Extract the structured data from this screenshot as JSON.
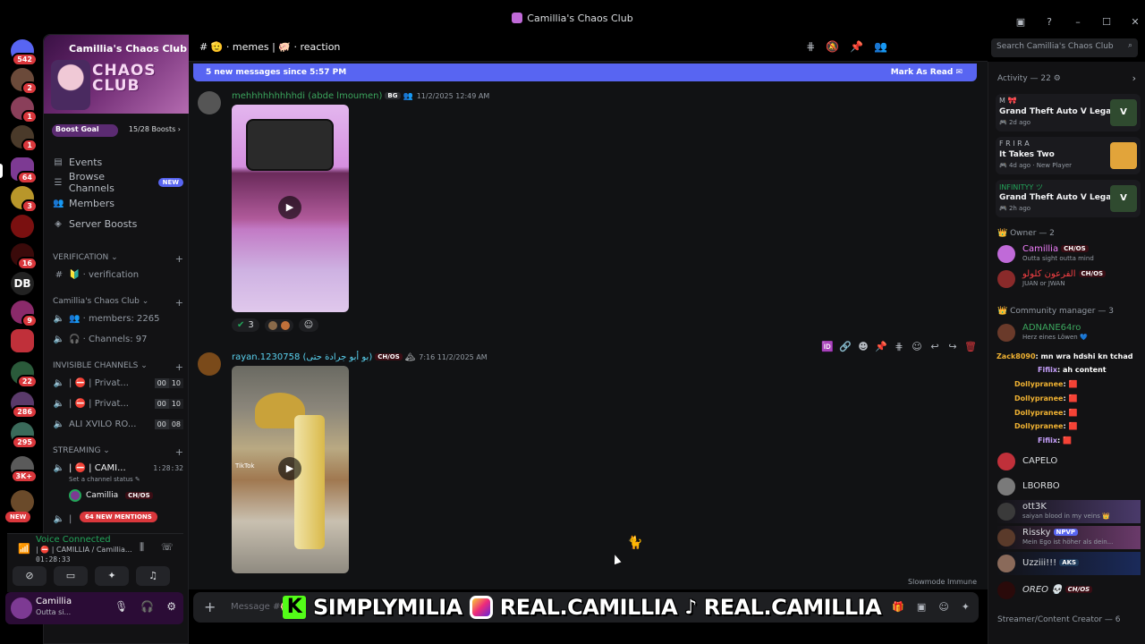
{
  "window": {
    "title": "Camillia's Chaos Club"
  },
  "rail": {
    "badges": [
      "542",
      "2",
      "1",
      "1",
      "64",
      "3",
      "16",
      "9",
      "22",
      "286",
      "295",
      "3K+"
    ],
    "new_label": "NEW"
  },
  "server": {
    "name": "Camillia's Chaos Club",
    "banner_logo_line1": "CHAOS",
    "banner_logo_line2": "CLUB",
    "boost_goal": "Boost Goal",
    "boost_count": "15/28 Boosts ›"
  },
  "nav": {
    "events": "Events",
    "browse_channels": "Browse Channels",
    "browse_new": "NEW",
    "members": "Members",
    "server_boosts": "Server Boosts"
  },
  "categories": {
    "verification": "VERIFICATION ⌄",
    "chaos_club": "Camillia's Chaos Club ⌄",
    "invisible": "INVISIBLE CHANNELS ⌄",
    "streaming": "STREAMING ⌄"
  },
  "channels": {
    "verification": "🔰 · verification",
    "members": "👥 · members: 2265",
    "channels_count": "🎧 · Channels: 97",
    "private1": "| ⛔ | Privat...",
    "private1_counts": [
      "00",
      "10"
    ],
    "private2": "| ⛔ | Privat...",
    "private2_counts": [
      "00",
      "10"
    ],
    "ali": "ALI XVILO RO...",
    "ali_counts": [
      "00",
      "08"
    ],
    "cami": "| ⛔ | CAMI...",
    "cami_time": "1:28:32",
    "set_status": "Set a channel status ✎",
    "voice_user": "Camillia",
    "voice_user_tag": "CH/OS",
    "mentions": "64 NEW MENTIONS"
  },
  "voice": {
    "title": "Voice Connected",
    "channel": "| ⛔ | CAMILLIA / Camillia...",
    "time": "01:28:33"
  },
  "user": {
    "name": "Camillia",
    "status": "Outta si..."
  },
  "header": {
    "crumb": "# 🫡 · memes  |  🐖 · reaction",
    "search_placeholder": "Search Camillia's Chaos Club"
  },
  "banner": {
    "new_messages": "5 new messages since 5:57 PM",
    "mark_read": "Mark As Read"
  },
  "messages": [
    {
      "author": "mehhhhhhhhhdi (abde lmoumen)",
      "tag": "BG",
      "time": "11/2/2025 12:49 AM",
      "reaction_count": "3"
    },
    {
      "author": "rayan.1230758 (بو أبو جرادة حتى)",
      "tag": "CH/OS",
      "time": "11/2/2025 7:16 AM",
      "watermark": "TikTok"
    }
  ],
  "slowmode": "Slowmode Immune",
  "composer": {
    "placeholder": "Message #🐖..."
  },
  "overlay": {
    "kick": "SIMPLYMILIA",
    "instagram": "REAL.CAMILLIA",
    "tiktok": "REAL.CAMILLIA"
  },
  "activity": {
    "header": "Activity — 22 ⚙",
    "cards": [
      {
        "user": "M 🎀",
        "game": "Grand Theft Auto V Legacy",
        "time": "🎮 2d ago"
      },
      {
        "user": "F R I R A",
        "game": "It Takes Two",
        "time": "🎮 4d ago · New Player"
      },
      {
        "user": "INFINITYY ツ",
        "game": "Grand Theft Auto V Legacy",
        "time": "🎮 2h ago"
      }
    ]
  },
  "members": {
    "owner_header": "Owner — 2",
    "owner": [
      {
        "name": "Camillia",
        "tag": "CH/OS",
        "status": "Outta sight outta mind"
      },
      {
        "name": "الفرعون كلولو",
        "tag": "CH/OS",
        "status": "JUAN or JWAN"
      }
    ],
    "cm_header": "Community manager — 3",
    "cm": [
      {
        "name": "ADNANE64ro",
        "status": "Herz eines Löwen 💙"
      }
    ],
    "others": [
      {
        "name": "CAPELO",
        "status": ""
      },
      {
        "name": "LBORBO",
        "status": ""
      },
      {
        "name": "ott3K",
        "status": "saiyan blood in my veins 👑"
      },
      {
        "name": "Rissky",
        "tag": "NPVP",
        "status": "Mein Ego ist höher als dein..."
      },
      {
        "name": "Uzziii!!!",
        "tag": "AKS",
        "status": ""
      },
      {
        "name": "OREO 💀",
        "tag": "CH/OS",
        "status": ""
      }
    ],
    "streamer_header": "Streamer/Content Creator — 6"
  },
  "chatfeed": [
    {
      "name": "Zack8090",
      "text": ": mn wra hdshi kn tchad"
    },
    {
      "name": "Fifiix",
      "text": ": ah content"
    },
    {
      "name": "Dollypranee",
      "text": ": 🟥"
    },
    {
      "name": "Dollypranee",
      "text": ": 🟥"
    },
    {
      "name": "Dollypranee",
      "text": ": 🟥"
    },
    {
      "name": "Dollypranee",
      "text": ": 🟥"
    },
    {
      "name": "Fifiix",
      "text": ": 🟥"
    }
  ]
}
